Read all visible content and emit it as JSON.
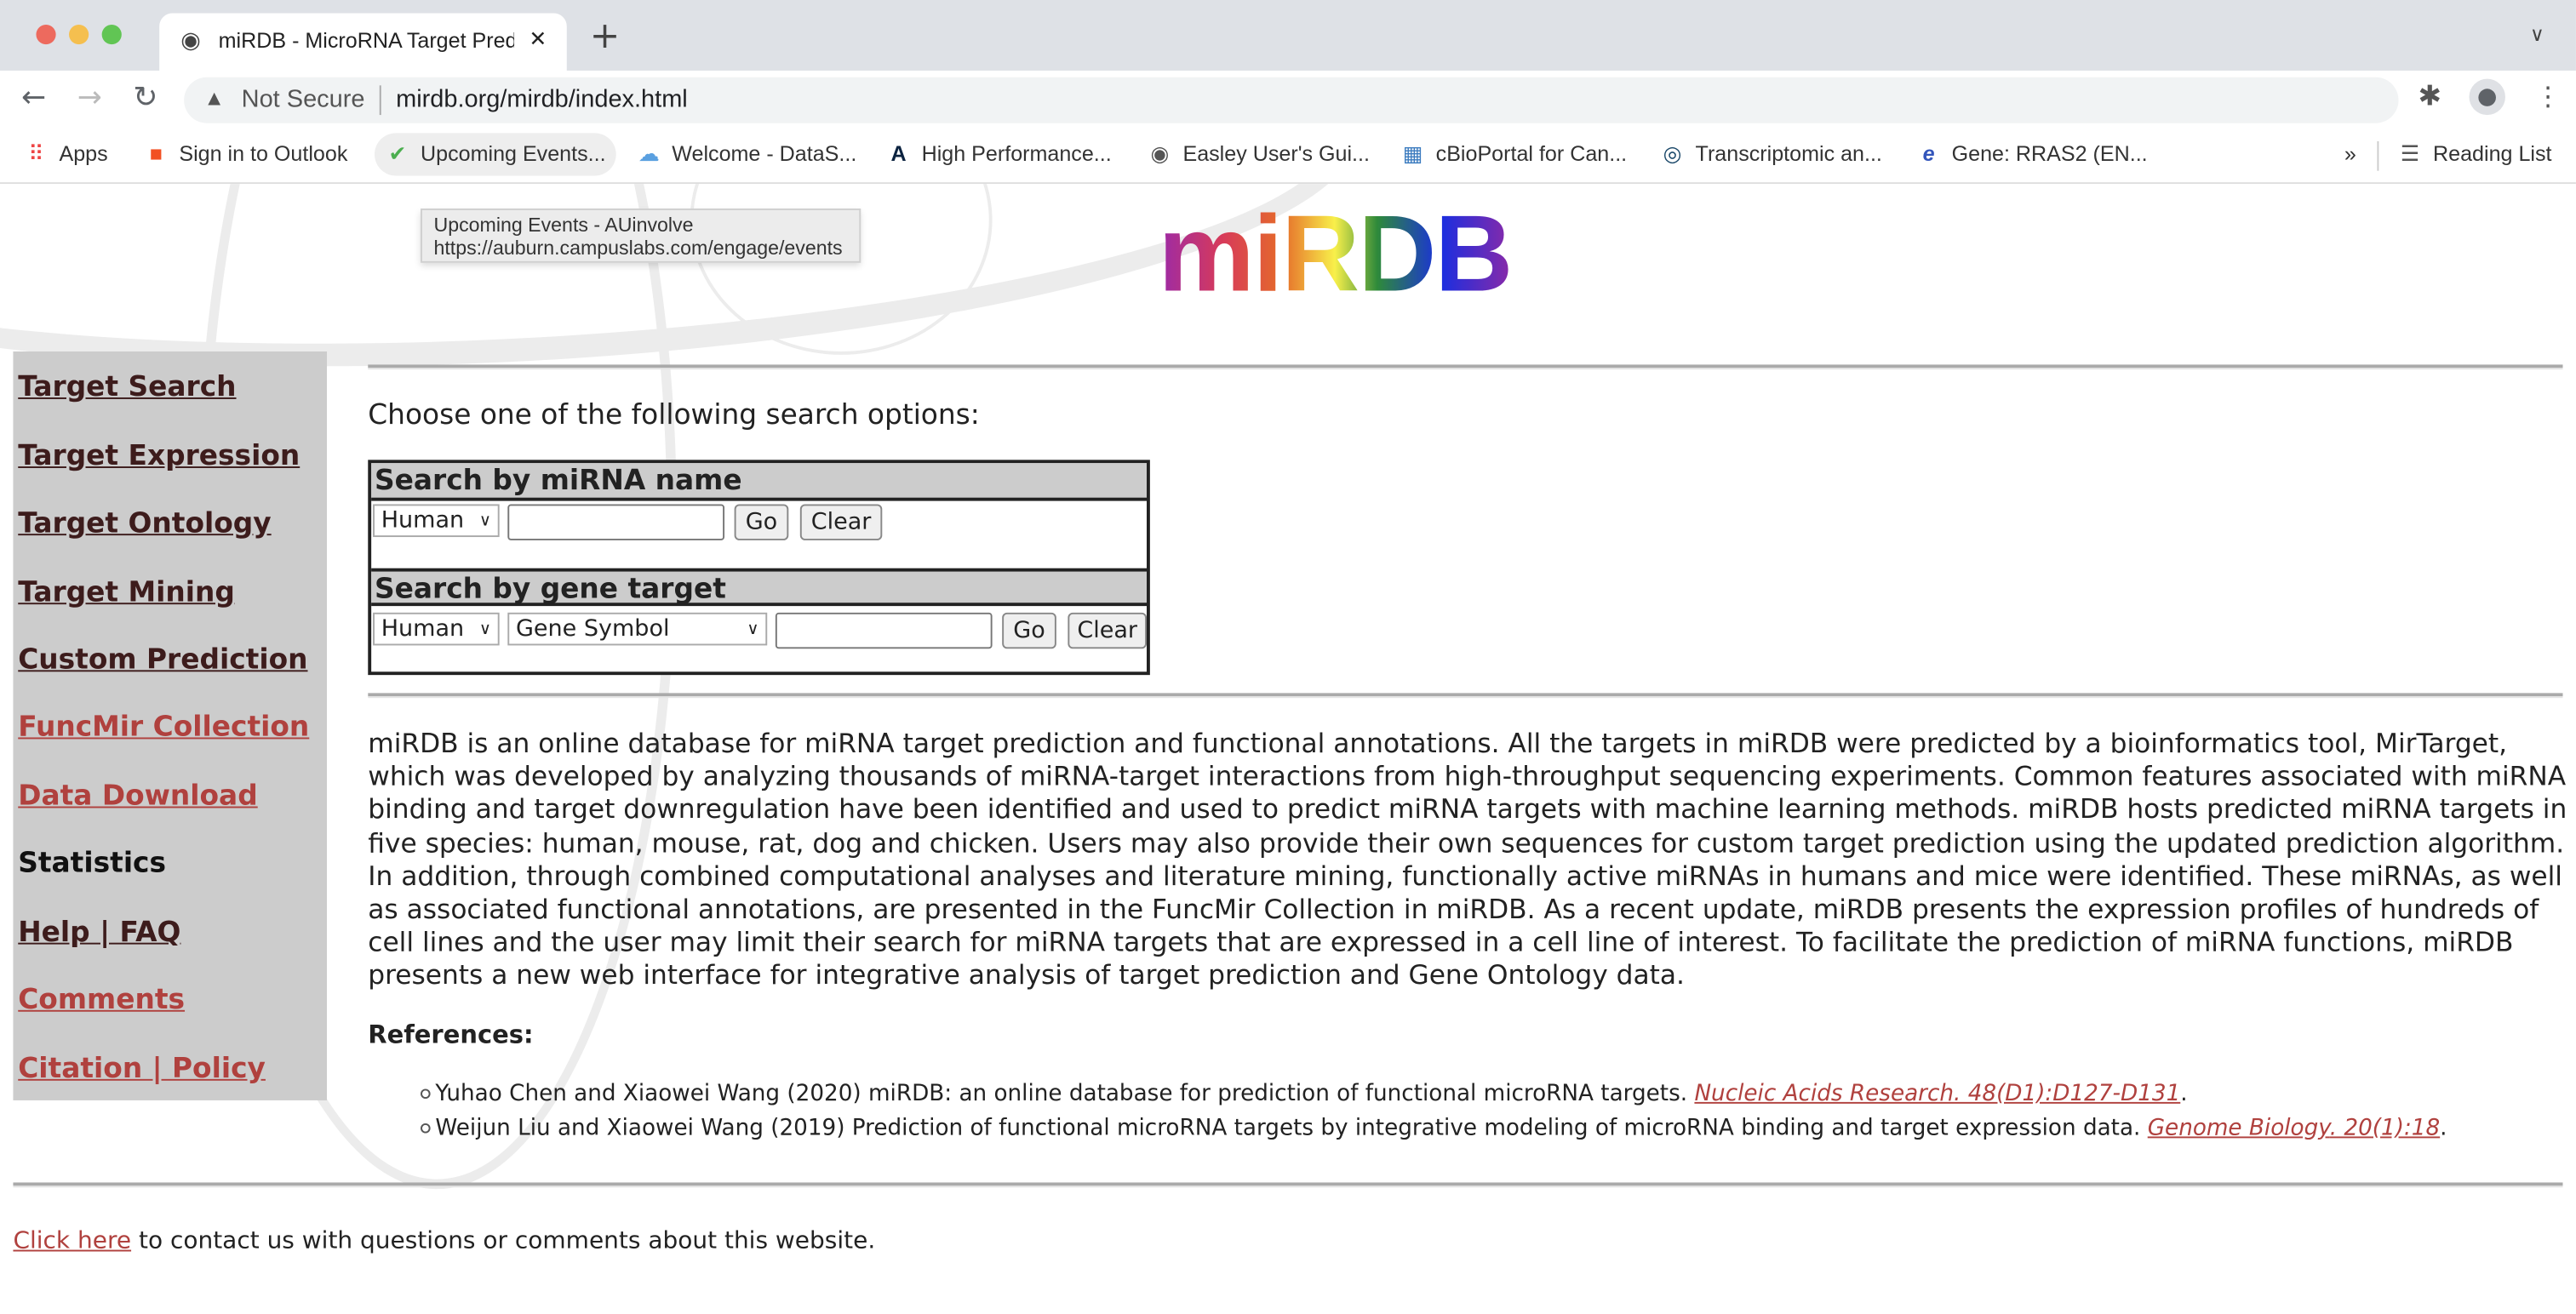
{
  "browser": {
    "tab_title": "miRDB - MicroRNA Target Pred",
    "security_label": "Not Secure",
    "url": "mirdb.org/mirdb/index.html",
    "bookmarks": [
      "Apps",
      "Sign in to Outlook",
      "Upcoming Events...",
      "Welcome - DataS...",
      "High Performance...",
      "Easley User's Gui...",
      "cBioPortal for Can...",
      "Transcriptomic an...",
      "Gene: RRAS2 (EN..."
    ],
    "reading_list": "Reading List",
    "tooltip": {
      "title": "Upcoming Events - AUinvolve",
      "url": "https://auburn.campuslabs.com/engage/events"
    }
  },
  "logo_text": "miRDB",
  "sidebar": {
    "items": [
      {
        "label": "Target Search"
      },
      {
        "label": "Target Expression"
      },
      {
        "label": "Target Ontology"
      },
      {
        "label": "Target Mining"
      },
      {
        "label": "Custom Prediction"
      },
      {
        "label": "FuncMir Collection"
      },
      {
        "label": "Data Download"
      },
      {
        "label": "Statistics"
      },
      {
        "label": "Help | FAQ"
      },
      {
        "label": "Comments"
      },
      {
        "label": "Citation | Policy"
      }
    ]
  },
  "main": {
    "choose_label": "Choose one of the following search options:",
    "mirna_search": {
      "heading": "Search by miRNA name",
      "species": "Human",
      "go": "Go",
      "clear": "Clear"
    },
    "gene_search": {
      "heading": "Search by gene target",
      "species": "Human",
      "id_type": "Gene Symbol",
      "go": "Go",
      "clear": "Clear"
    },
    "description": "miRDB is an online database for miRNA target prediction and functional annotations. All the targets in miRDB were predicted by a bioinformatics tool, MirTarget, which was developed by analyzing thousands of miRNA-target interactions from high-throughput sequencing experiments. Common features associated with miRNA binding and target downregulation have been identified and used to predict miRNA targets with machine learning methods. miRDB hosts predicted miRNA targets in five species: human, mouse, rat, dog and chicken. Users may also provide their own sequences for custom target prediction using the updated prediction algorithm. In addition, through combined computational analyses and literature mining, functionally active miRNAs in humans and mice were identified. These miRNAs, as well as associated functional annotations, are presented in the FuncMir Collection in miRDB. As a recent update, miRDB presents the expression profiles of hundreds of cell lines and the user may limit their search for miRNA targets that are expressed in a cell line of interest. To facilitate the prediction of miRNA functions, miRDB presents a new web interface for integrative analysis of target prediction and Gene Ontology data.",
    "references_heading": "References:",
    "references": [
      {
        "text": "Yuhao Chen and Xiaowei Wang (2020) miRDB: an online database for prediction of functional microRNA targets. ",
        "journal": "Nucleic Acids Research",
        "citation": ". 48(D1):D127-D131"
      },
      {
        "text": "Weijun Liu and Xiaowei Wang (2019) Prediction of functional microRNA targets by integrative modeling of microRNA binding and target expression data. ",
        "journal": "Genome Biology",
        "citation": ". 20(1):18"
      }
    ],
    "contact_link": "Click here",
    "contact_text": " to contact us with questions or comments about this website."
  }
}
